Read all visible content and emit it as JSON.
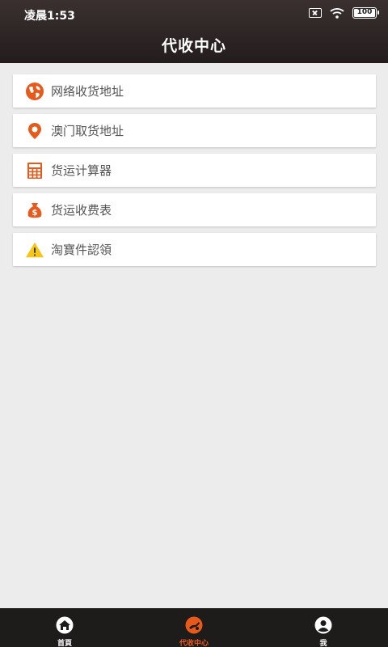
{
  "status_bar": {
    "time": "凌晨1:53",
    "battery": "100"
  },
  "header": {
    "title": "代收中心"
  },
  "menu": {
    "items": [
      {
        "label": "网络收货地址",
        "icon": "globe-icon"
      },
      {
        "label": "澳门取货地址",
        "icon": "location-pin-icon"
      },
      {
        "label": "货运计算器",
        "icon": "calculator-icon"
      },
      {
        "label": "货运收费表",
        "icon": "money-bag-icon"
      },
      {
        "label": "淘寶件認領",
        "icon": "warning-icon"
      }
    ]
  },
  "tabbar": {
    "tabs": [
      {
        "label": "首頁",
        "icon": "home-icon"
      },
      {
        "label": "代收中心",
        "icon": "collection-center-icon"
      },
      {
        "label": "我",
        "icon": "user-icon"
      }
    ],
    "active_index": 1
  },
  "colors": {
    "accent": "#e85a1c",
    "warning": "#f5c518",
    "header_bg": "#2b2323",
    "tabbar_bg": "#1e1b1b"
  }
}
